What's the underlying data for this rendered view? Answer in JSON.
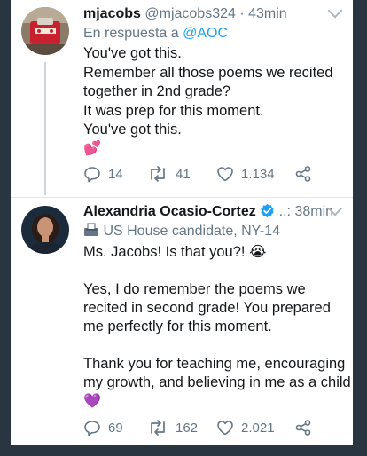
{
  "tweets": [
    {
      "display_name": "mjacobs",
      "handle": "@mjacobs324",
      "separator": "·",
      "time": "43min",
      "reply_prefix": "En respuesta a",
      "reply_to": "@AOC",
      "lines": [
        "You've got this.",
        "Remember all those poems we recited",
        "together in 2nd grade?",
        "It was prep for this moment.",
        "You've got this."
      ],
      "emoji": "💕",
      "replies": "14",
      "retweets": "41",
      "likes": "1.134"
    },
    {
      "display_name": "Alexandria Ocasio-Cortez",
      "ellipsis": "..:",
      "time": "38min",
      "label_icon": "ballot-box-icon",
      "label": "US House candidate, NY-14",
      "lines": [
        "Ms. Jacobs! Is that you?! 😭",
        "",
        "Yes, I do remember the poems we",
        "recited in second grade! You prepared",
        "me perfectly for this moment.",
        "",
        "Thank you for teaching me, encouraging",
        "my growth, and believing in me as a child"
      ],
      "emoji": "💜",
      "replies": "69",
      "retweets": "162",
      "likes": "2.021"
    }
  ],
  "colors": {
    "link": "#1da1f2",
    "muted": "#657786",
    "verified": "#1da1f2",
    "page_bg": "#2a3542"
  }
}
